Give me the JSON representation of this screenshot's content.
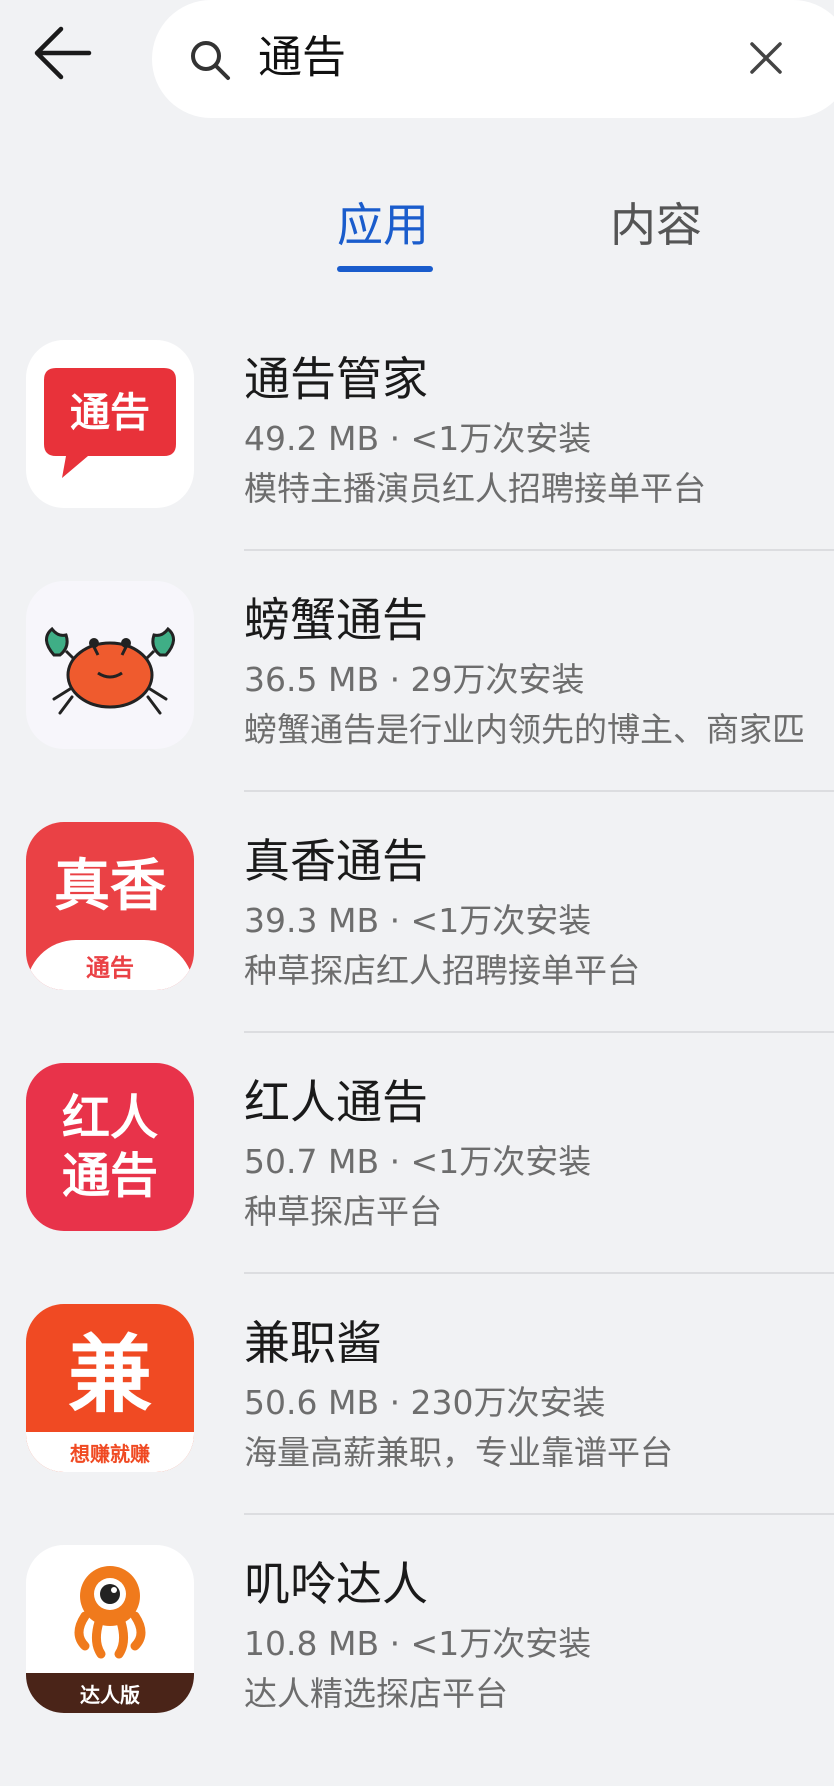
{
  "search": {
    "query": "通告"
  },
  "tabs": [
    {
      "label": "应用"
    },
    {
      "label": "内容"
    }
  ],
  "apps": [
    {
      "name": "通告管家",
      "meta": "49.2 MB · <1万次安装",
      "desc": "模特主播演员红人招聘接单平台",
      "icon_text": "通告",
      "icon_bg": "#ffffff",
      "icon_accent": "#e8323a"
    },
    {
      "name": "螃蟹通告",
      "meta": "36.5 MB · 29万次安装",
      "desc": "螃蟹通告是行业内领先的博主、商家匹",
      "icon_bg": "#f7f6fb",
      "icon_accent": "#ef5b2e"
    },
    {
      "name": "真香通告",
      "meta": "39.3 MB · <1万次安装",
      "desc": "种草探店红人招聘接单平台",
      "icon_text": "真香",
      "icon_subtext": "通告",
      "icon_bg": "#ea4145"
    },
    {
      "name": "红人通告",
      "meta": "50.7 MB · <1万次安装",
      "desc": "种草探店平台",
      "icon_line1": "红人",
      "icon_line2": "通告",
      "icon_bg": "#e8334a"
    },
    {
      "name": "兼职酱",
      "meta": "50.6 MB · 230万次安装",
      "desc": "海量高薪兼职，专业靠谱平台",
      "icon_text": "兼",
      "icon_subtext": "想赚就赚",
      "icon_bg": "#f04a23"
    },
    {
      "name": "叽呤达人",
      "meta": "10.8 MB · <1万次安装",
      "desc": "达人精选探店平台",
      "icon_subtext": "达人版",
      "icon_bg": "#ffffff",
      "icon_accent": "#f07a1c"
    }
  ]
}
